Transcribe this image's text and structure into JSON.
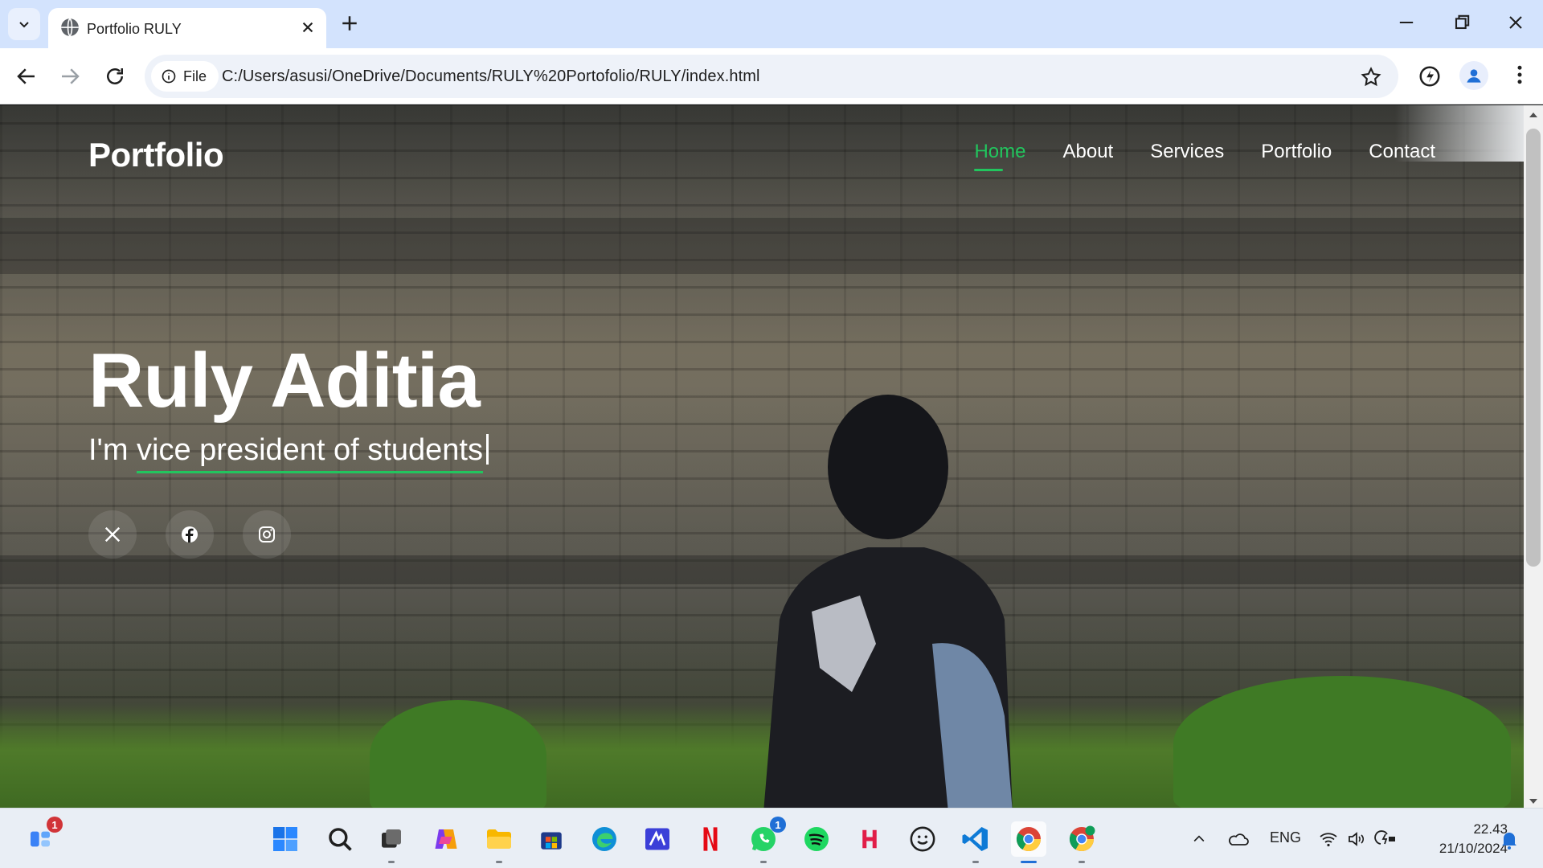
{
  "browser": {
    "tab_title": "Portfolio RULY",
    "site_info_label": "File",
    "url": "C:/Users/asusi/OneDrive/Documents/RULY%20Portofolio/RULY/index.html"
  },
  "page": {
    "logo": "Portfolio",
    "nav": [
      {
        "label": "Home",
        "active": true
      },
      {
        "label": "About"
      },
      {
        "label": "Services"
      },
      {
        "label": "Portfolio"
      },
      {
        "label": "Contact"
      }
    ],
    "hero_name": "Ruly Aditia",
    "hero_prefix": "I'm ",
    "hero_typed": "vice president of students",
    "accent_color": "#22c55e",
    "socials": [
      {
        "icon": "x-twitter-icon"
      },
      {
        "icon": "facebook-icon"
      },
      {
        "icon": "instagram-icon"
      }
    ]
  },
  "taskbar": {
    "widgets_badge": "1",
    "whatsapp_badge": "1",
    "language": "ENG",
    "time": "22.43",
    "date": "21/10/2024",
    "apps": [
      "start-icon",
      "search-icon",
      "task-view-icon",
      "copilot-icon",
      "file-explorer-icon",
      "microsoft-store-icon",
      "edge-icon",
      "app-icon",
      "netflix-icon",
      "whatsapp-icon",
      "spotify-icon",
      "app-h-icon",
      "emoji-app-icon",
      "vscode-icon",
      "chrome-icon",
      "chrome-profile-icon"
    ]
  }
}
